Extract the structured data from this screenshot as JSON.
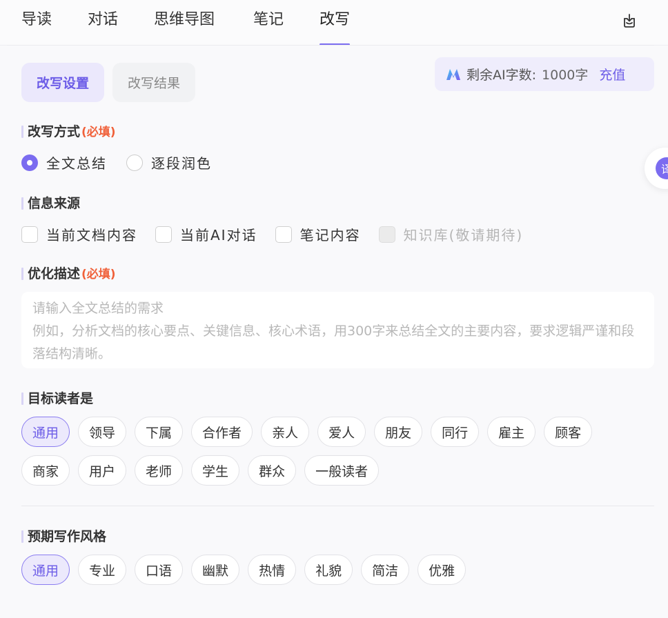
{
  "tabs": [
    {
      "label": "导读"
    },
    {
      "label": "对话"
    },
    {
      "label": "思维导图"
    },
    {
      "label": "笔记"
    },
    {
      "label": "改写"
    }
  ],
  "active_tab": "改写",
  "subtabs": {
    "settings": "改写设置",
    "result": "改写结果"
  },
  "quota": {
    "label": "剩余AI字数:",
    "count": "1000字",
    "recharge": "充值"
  },
  "float_button": {
    "char": "译"
  },
  "rewrite_mode": {
    "title": "改写方式",
    "required": "(必填)",
    "options": [
      {
        "label": "全文总结",
        "checked": true
      },
      {
        "label": "逐段润色",
        "checked": false
      }
    ]
  },
  "sources": {
    "title": "信息来源",
    "options": [
      {
        "label": "当前文档内容"
      },
      {
        "label": "当前AI对话"
      },
      {
        "label": "笔记内容"
      },
      {
        "label": "知识库(敬请期待)"
      }
    ]
  },
  "description": {
    "title": "优化描述",
    "required": "(必填)",
    "placeholder_line1": "请输入全文总结的需求",
    "placeholder_line2": "例如，分析文档的核心要点、关键信息、核心术语，用300字来总结全文的主要内容，要求逻辑严谨和段落结构清晰。"
  },
  "readers": {
    "title": "目标读者是",
    "chips": [
      "通用",
      "领导",
      "下属",
      "合作者",
      "亲人",
      "爱人",
      "朋友",
      "同行",
      "雇主",
      "顾客",
      "商家",
      "用户",
      "老师",
      "学生",
      "群众",
      "一般读者"
    ],
    "selected": "通用"
  },
  "style": {
    "title": "预期写作风格",
    "chips": [
      "通用",
      "专业",
      "口语",
      "幽默",
      "热情",
      "礼貌",
      "简洁",
      "优雅"
    ],
    "selected": "通用"
  },
  "colors": {
    "accent": "#7b6cf0",
    "required": "#f0613a"
  }
}
